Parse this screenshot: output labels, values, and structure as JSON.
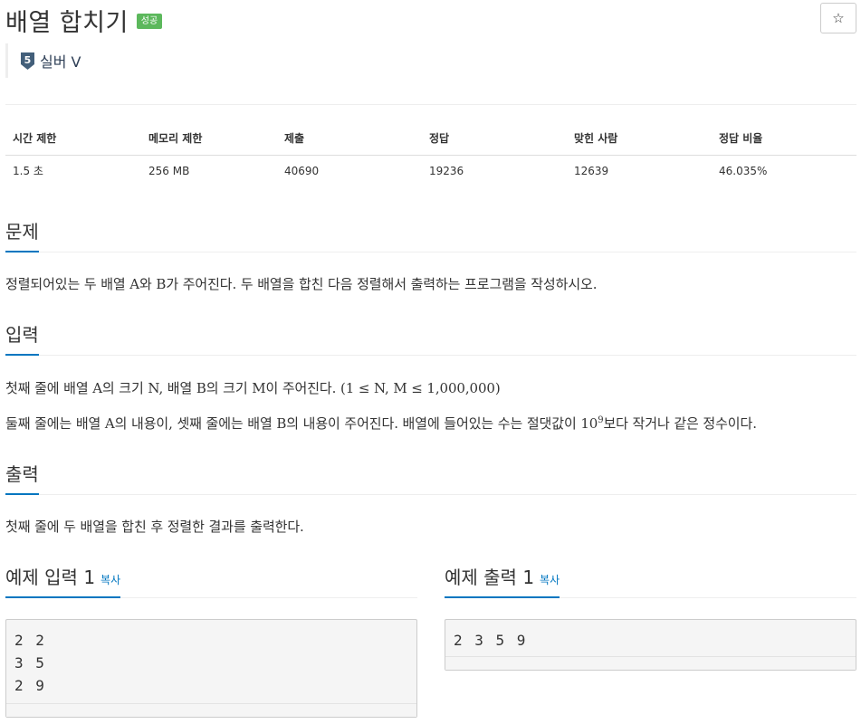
{
  "problem": {
    "title": "배열 합치기",
    "result_badge": "성공",
    "star_icon": "☆",
    "tier": {
      "number": "5",
      "label": "실버 V",
      "color": "#435f7a"
    }
  },
  "info_table": {
    "headers": [
      "시간 제한",
      "메모리 제한",
      "제출",
      "정답",
      "맞힌 사람",
      "정답 비율"
    ],
    "values": [
      "1.5 초",
      "256 MB",
      "40690",
      "19236",
      "12639",
      "46.035%"
    ]
  },
  "sections": {
    "description": {
      "heading": "문제",
      "text": "정렬되어있는 두 배열 A와 B가 주어진다. 두 배열을 합친 다음 정렬해서 출력하는 프로그램을 작성하시오."
    },
    "input": {
      "heading": "입력",
      "line1": "첫째 줄에 배열 A의 크기 N, 배열 B의 크기 M이 주어진다. (1 ≤ N, M ≤ 1,000,000)",
      "line2_pre": "둘째 줄에는 배열 A의 내용이, 셋째 줄에는 배열 B의 내용이 주어진다. 배열에 들어있는 수는 절댓값이 10",
      "line2_sup": "9",
      "line2_post": "보다 작거나 같은 정수이다."
    },
    "output": {
      "heading": "출력",
      "text": "첫째 줄에 두 배열을 합친 후 정렬한 결과를 출력한다."
    }
  },
  "samples": {
    "copy_label": "복사",
    "input": {
      "heading": "예제 입력 1",
      "content": "2 2\n3 5\n2 9"
    },
    "output": {
      "heading": "예제 출력 1",
      "content": "2 3 5 9"
    }
  },
  "colors": {
    "accent": "#0076c0",
    "success": "#5cb85c"
  }
}
